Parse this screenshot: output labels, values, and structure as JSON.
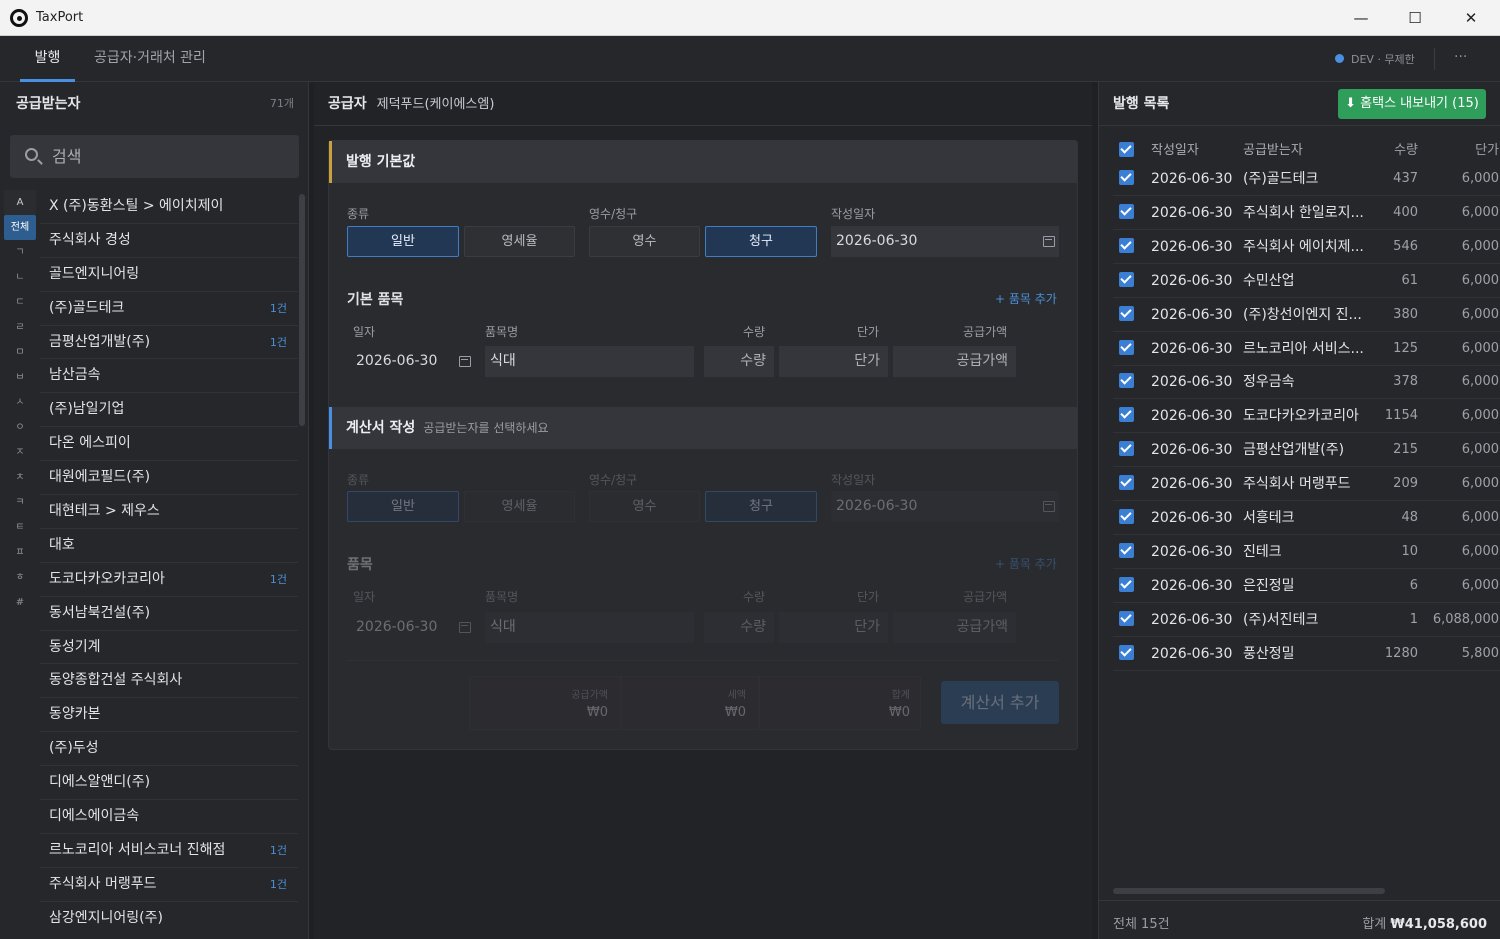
{
  "window": {
    "title": "TaxPort",
    "minimize": "—",
    "maximize": "☐",
    "close": "✕"
  },
  "tabs": [
    {
      "label": "발행"
    },
    {
      "label": "공급자·거래처 관리"
    }
  ],
  "env": {
    "label": "DEV · 무제한",
    "more": "···",
    "dot_color": "#4a90e2"
  },
  "left": {
    "title": "공급받는자",
    "count": "71개",
    "search_placeholder": "검색",
    "index": [
      "A",
      "전체",
      "ㄱ",
      "ㄴ",
      "ㄷ",
      "ㄹ",
      "ㅁ",
      "ㅂ",
      "ㅅ",
      "ㅇ",
      "ㅈ",
      "ㅊ",
      "ㅋ",
      "ㅌ",
      "ㅍ",
      "ㅎ",
      "#"
    ],
    "vendors": [
      {
        "name": "X (주)동환스틸 > 에이치제이",
        "badge": ""
      },
      {
        "name": "주식회사 경성",
        "badge": ""
      },
      {
        "name": "골드엔지니어링",
        "badge": ""
      },
      {
        "name": "(주)골드테크",
        "badge": "1건"
      },
      {
        "name": "금평산업개발(주)",
        "badge": "1건"
      },
      {
        "name": "남산금속",
        "badge": ""
      },
      {
        "name": "(주)남일기업",
        "badge": ""
      },
      {
        "name": "다온 에스피이",
        "badge": ""
      },
      {
        "name": "대원에코필드(주)",
        "badge": ""
      },
      {
        "name": "대현테크 > 제우스",
        "badge": ""
      },
      {
        "name": "대호",
        "badge": ""
      },
      {
        "name": "도코다카오카코리아",
        "badge": "1건"
      },
      {
        "name": "동서남북건설(주)",
        "badge": ""
      },
      {
        "name": "동성기계",
        "badge": ""
      },
      {
        "name": "동양종합건설 주식회사",
        "badge": ""
      },
      {
        "name": "동양카본",
        "badge": ""
      },
      {
        "name": "(주)두성",
        "badge": ""
      },
      {
        "name": "디에스알앤디(주)",
        "badge": ""
      },
      {
        "name": "디에스에이금속",
        "badge": ""
      },
      {
        "name": "르노코리아 서비스코너 진해점",
        "badge": "1건"
      },
      {
        "name": "주식회사 머랭푸드",
        "badge": "1건"
      },
      {
        "name": "삼강엔지니어링(주)",
        "badge": ""
      }
    ]
  },
  "mid": {
    "supplier_label": "공급자",
    "supplier_name": "제덕푸드(케이에스엠)",
    "basic": {
      "title": "발행 기본값",
      "type_label": "종류",
      "type_options": [
        "일반",
        "영세율"
      ],
      "receipt_label": "영수/청구",
      "receipt_options": [
        "영수",
        "청구"
      ],
      "date_label": "작성일자",
      "date": "2026-06-30",
      "items_title": "기본 품목",
      "add_item": "+ 품목 추가",
      "cols": [
        "일자",
        "품목명",
        "수량",
        "단가",
        "공급가액"
      ],
      "row": {
        "date": "2026-06-30",
        "name": "식대",
        "qty": "수량",
        "price": "단가",
        "supply": "공급가액"
      }
    },
    "invoice": {
      "title": "계산서 작성",
      "hint": "공급받는자를 선택하세요",
      "type_label": "종류",
      "type_options": [
        "일반",
        "영세율"
      ],
      "receipt_label": "영수/청구",
      "receipt_options": [
        "영수",
        "청구"
      ],
      "date_label": "작성일자",
      "date": "2026-06-30",
      "items_title": "품목",
      "add_item": "+ 품목 추가",
      "cols": [
        "일자",
        "품목명",
        "수량",
        "단가",
        "공급가액"
      ],
      "row": {
        "date": "2026-06-30",
        "name": "식대",
        "qty": "수량",
        "price": "단가",
        "supply": "공급가액"
      },
      "totals": [
        {
          "label": "공급가액",
          "value": "₩0"
        },
        {
          "label": "세액",
          "value": "₩0"
        },
        {
          "label": "합계",
          "value": "₩0"
        }
      ],
      "add_button": "계산서 추가"
    }
  },
  "right": {
    "title": "발행 목록",
    "export_button": "⬇ 홈택스 내보내기 (15)",
    "columns": [
      "작성일자",
      "공급받는자",
      "수량",
      "단가"
    ],
    "rows": [
      {
        "date": "2026-06-30",
        "name": "(주)골드테크",
        "qty": "437",
        "price": "6,000"
      },
      {
        "date": "2026-06-30",
        "name": "주식회사 한일로지...",
        "qty": "400",
        "price": "6,000"
      },
      {
        "date": "2026-06-30",
        "name": "주식회사 에이치제...",
        "qty": "546",
        "price": "6,000"
      },
      {
        "date": "2026-06-30",
        "name": "수민산업",
        "qty": "61",
        "price": "6,000"
      },
      {
        "date": "2026-06-30",
        "name": "(주)창선이엔지 진...",
        "qty": "380",
        "price": "6,000"
      },
      {
        "date": "2026-06-30",
        "name": "르노코리아 서비스...",
        "qty": "125",
        "price": "6,000"
      },
      {
        "date": "2026-06-30",
        "name": "정우금속",
        "qty": "378",
        "price": "6,000"
      },
      {
        "date": "2026-06-30",
        "name": "도코다카오카코리아",
        "qty": "1154",
        "price": "6,000"
      },
      {
        "date": "2026-06-30",
        "name": "금평산업개발(주)",
        "qty": "215",
        "price": "6,000"
      },
      {
        "date": "2026-06-30",
        "name": "주식회사 머랭푸드",
        "qty": "209",
        "price": "6,000"
      },
      {
        "date": "2026-06-30",
        "name": "서흥테크",
        "qty": "48",
        "price": "6,000"
      },
      {
        "date": "2026-06-30",
        "name": "진테크",
        "qty": "10",
        "price": "6,000"
      },
      {
        "date": "2026-06-30",
        "name": "은진정밀",
        "qty": "6",
        "price": "6,000"
      },
      {
        "date": "2026-06-30",
        "name": "(주)서진테크",
        "qty": "1",
        "price": "6,088,000"
      },
      {
        "date": "2026-06-30",
        "name": "풍산정밀",
        "qty": "1280",
        "price": "5,800"
      }
    ],
    "footer_total_count": "전체 15건",
    "footer_sum_label": "합계",
    "footer_sum_value": "₩41,058,600"
  }
}
